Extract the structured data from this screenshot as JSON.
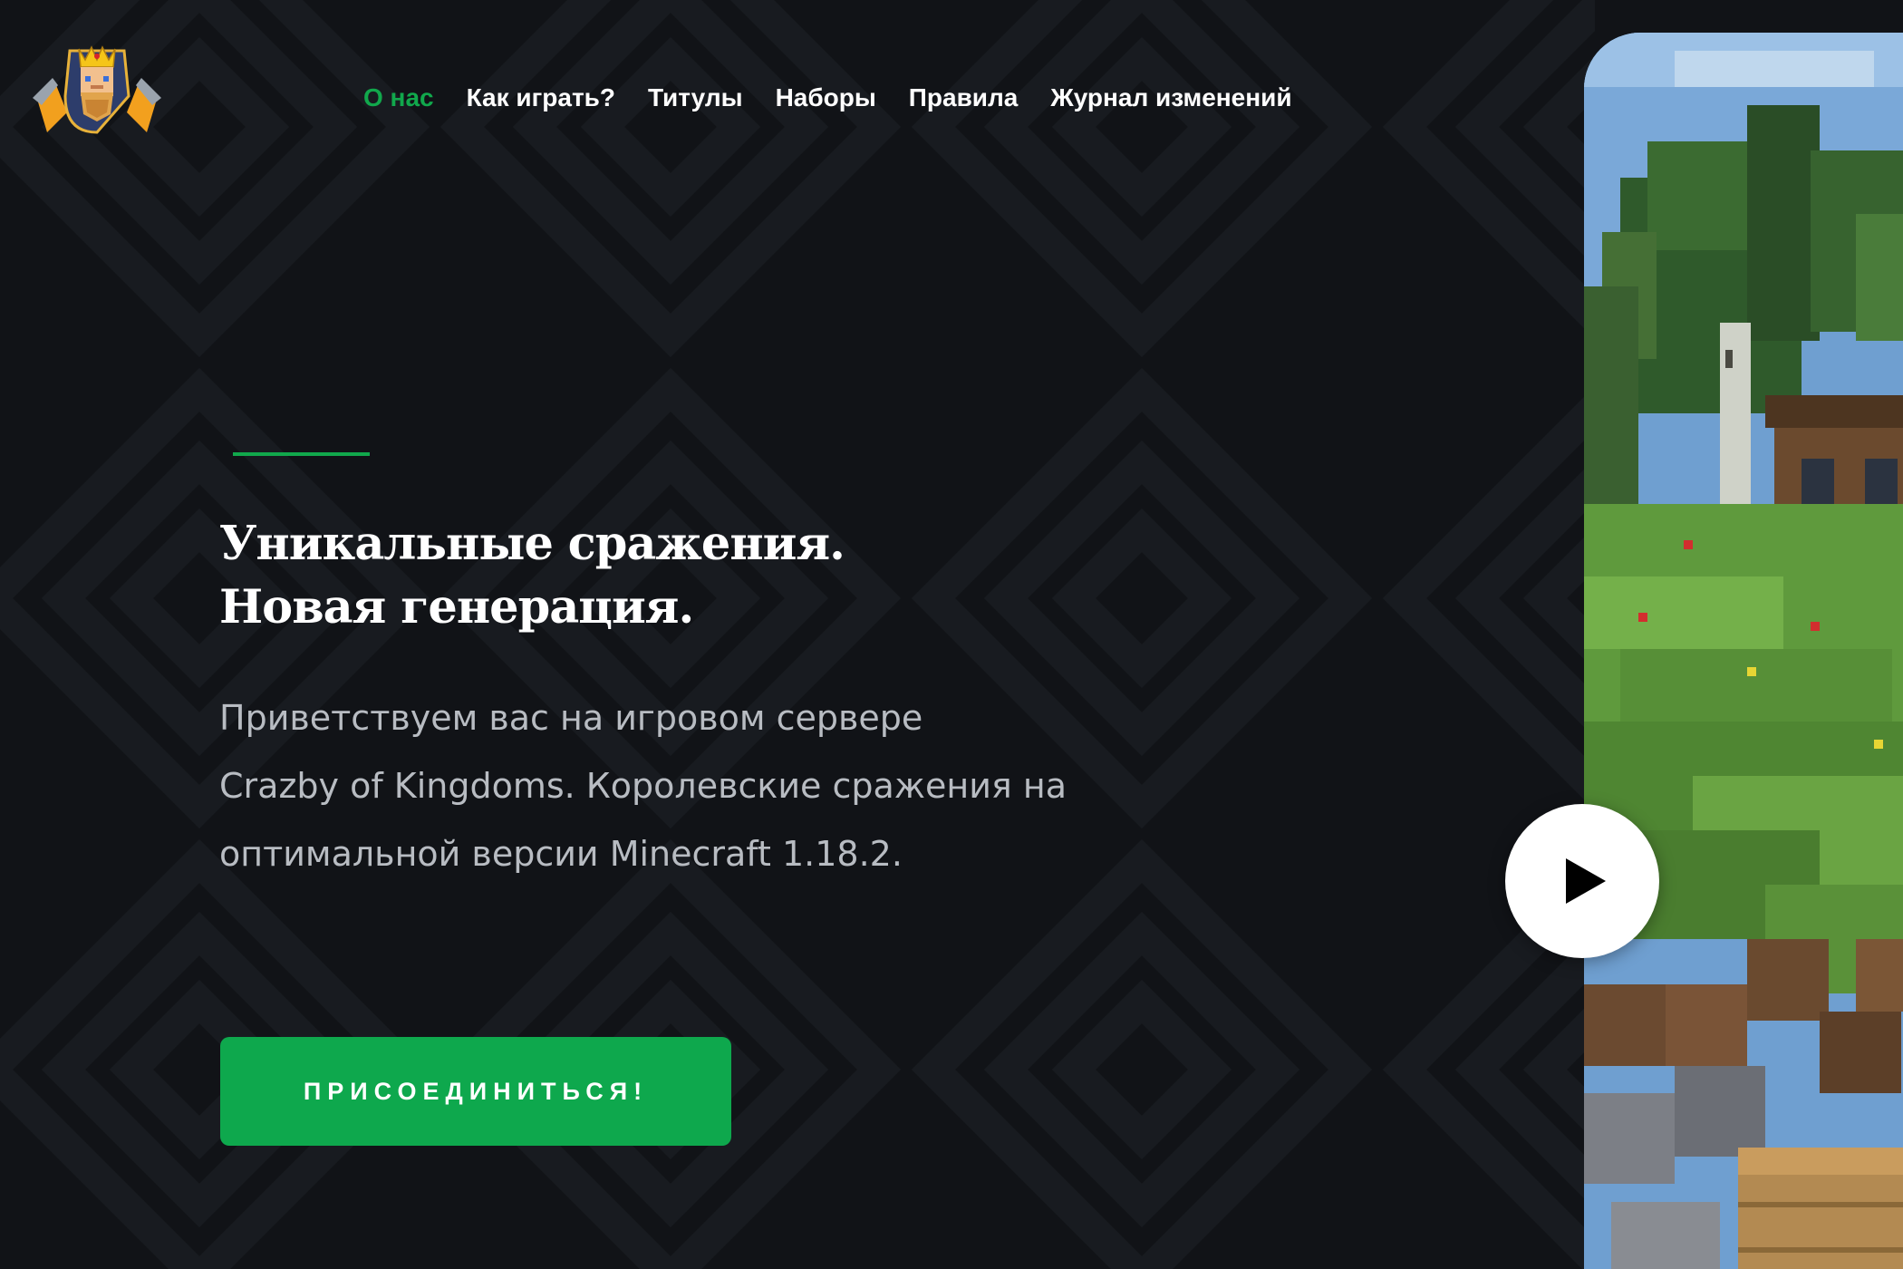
{
  "header": {
    "logo_icon": "kingdom-shield-logo",
    "nav": [
      {
        "label": "О нас",
        "active": true
      },
      {
        "label": "Как играть?",
        "active": false
      },
      {
        "label": "Титулы",
        "active": false
      },
      {
        "label": "Наборы",
        "active": false
      },
      {
        "label": "Правила",
        "active": false
      },
      {
        "label": "Журнал изменений",
        "active": false
      }
    ]
  },
  "hero": {
    "title_lines": [
      "Уникальные сражения.",
      "Новая генерация."
    ],
    "description_lines": [
      "Приветствуем вас на игровом сервере",
      "Crazby of Kingdoms. Королевские сражения на",
      "оптимальной версии Minecraft 1.18.2."
    ],
    "cta_label": "ПРИСОЕДИНИТЬСЯ!"
  },
  "media": {
    "play_icon": "play-icon",
    "preview": "minecraft-landscape-screenshot"
  },
  "colors": {
    "background": "#111317",
    "accent": "#11a84c",
    "text": "#ffffff",
    "muted_text": "#b8bcc2"
  }
}
